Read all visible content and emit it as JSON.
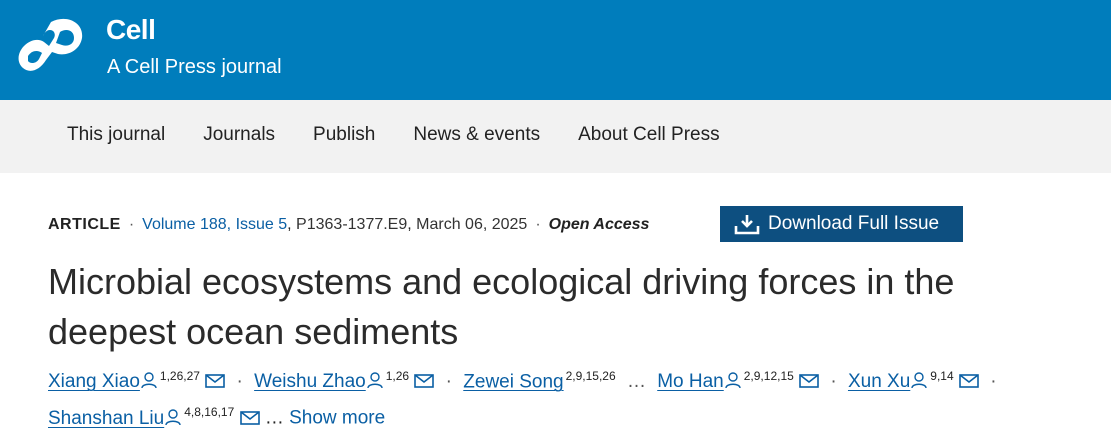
{
  "header": {
    "brand_title": "Cell",
    "brand_subtitle": "A Cell Press journal",
    "brand_color": "#007dbc"
  },
  "nav": {
    "items": [
      "This journal",
      "Journals",
      "Publish",
      "News & events",
      "About Cell Press"
    ]
  },
  "article": {
    "type": "ARTICLE",
    "volume": "Volume 188",
    "issue": "Issue 5",
    "pages": "P1363-1377.E9",
    "date": "March 06, 2025",
    "access": "Open Access",
    "download_label": "Download Full Issue",
    "title": "Microbial ecosystems and ecological driving forces in the deepest ocean sediments",
    "authors": [
      {
        "name": "Xiang Xiao",
        "aff": "1,26,27"
      },
      {
        "name": "Weishu Zhao",
        "aff": "1,26"
      },
      {
        "name": "Zewei Song",
        "aff": "2,9,15,26"
      },
      {
        "name": "Mo Han",
        "aff": "2,9,12,15"
      },
      {
        "name": "Xun Xu",
        "aff": "9,14"
      },
      {
        "name": "Shanshan Liu",
        "aff": "4,8,16,17"
      }
    ],
    "ellipsis": "…",
    "show_more": "Show more",
    "separator": "·"
  }
}
